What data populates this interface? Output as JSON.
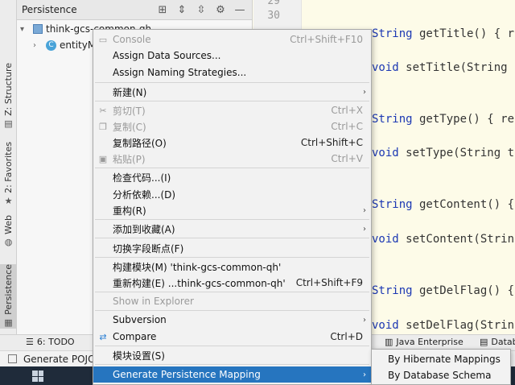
{
  "left_strip": {
    "tabs": [
      {
        "label": "Z: Structure",
        "icon": "structure-icon"
      },
      {
        "label": "2: Favorites",
        "icon": "star-icon"
      },
      {
        "label": "Web",
        "icon": "globe-icon"
      },
      {
        "label": "Persistence",
        "icon": "persistence-icon"
      }
    ]
  },
  "persistence_panel": {
    "title": "Persistence",
    "tree": [
      {
        "label": "think-gcs-common-qh"
      },
      {
        "label": "entityM"
      }
    ]
  },
  "gutter": {
    "lines": [
      "29",
      "30"
    ]
  },
  "editor": {
    "lines": [
      {
        "kw": "String",
        "rest": " getTitle() { r"
      },
      {
        "kw": "void",
        "rest": " setTitle(String "
      },
      {
        "kw": "String",
        "rest": " getType() { re"
      },
      {
        "kw": "void",
        "rest": " setType(String t"
      },
      {
        "kw": "String",
        "rest": " getContent() {"
      },
      {
        "kw": "void",
        "rest": " setContent(Strin"
      },
      {
        "kw": "String",
        "rest": " getDelFlag() {"
      },
      {
        "kw": "void",
        "rest": " setDelFlag(Strin"
      }
    ]
  },
  "context_menu": {
    "items": [
      {
        "label": "Console",
        "shortcut": "Ctrl+Shift+F10",
        "disabled": true,
        "icon": "console-icon"
      },
      {
        "label": "Assign Data Sources...",
        "shortcut": ""
      },
      {
        "label": "Assign Naming Strategies...",
        "shortcut": ""
      },
      {
        "label": "新建(N)",
        "submenu": true
      },
      {
        "label": "剪切(T)",
        "shortcut": "Ctrl+X",
        "disabled": true,
        "icon": "cut-icon"
      },
      {
        "label": "复制(C)",
        "shortcut": "Ctrl+C",
        "disabled": true,
        "icon": "copy-icon"
      },
      {
        "label": "复制路径(O)",
        "shortcut": "Ctrl+Shift+C"
      },
      {
        "label": "粘贴(P)",
        "shortcut": "Ctrl+V",
        "disabled": true,
        "icon": "paste-icon"
      },
      {
        "label": "检查代码...(I)",
        "shortcut": ""
      },
      {
        "label": "分析依赖...(D)",
        "shortcut": ""
      },
      {
        "label": "重构(R)",
        "submenu": true
      },
      {
        "label": "添加到收藏(A)",
        "submenu": true
      },
      {
        "label": "切换字段断点(F)",
        "shortcut": ""
      },
      {
        "label": "构建模块(M) 'think-gcs-common-qh'",
        "shortcut": ""
      },
      {
        "label": "重新构建(E) ...think-gcs-common-qh'",
        "shortcut": "Ctrl+Shift+F9"
      },
      {
        "label": "Show in Explorer",
        "disabled": true
      },
      {
        "label": "Subversion",
        "submenu": true
      },
      {
        "label": "Compare",
        "shortcut": "Ctrl+D",
        "icon": "compare-icon"
      },
      {
        "label": "模块设置(S)",
        "shortcut": ""
      },
      {
        "label": "Generate Persistence Mapping",
        "submenu": true,
        "selected": true
      }
    ]
  },
  "submenu": {
    "items": [
      "By Hibernate Mappings",
      "By Database Schema"
    ]
  },
  "bottom_bar": {
    "todo": "6: TODO",
    "java_enterprise": "Java Enterprise",
    "database": "Datab"
  },
  "status_bar": {
    "text": "Generate POJO"
  }
}
